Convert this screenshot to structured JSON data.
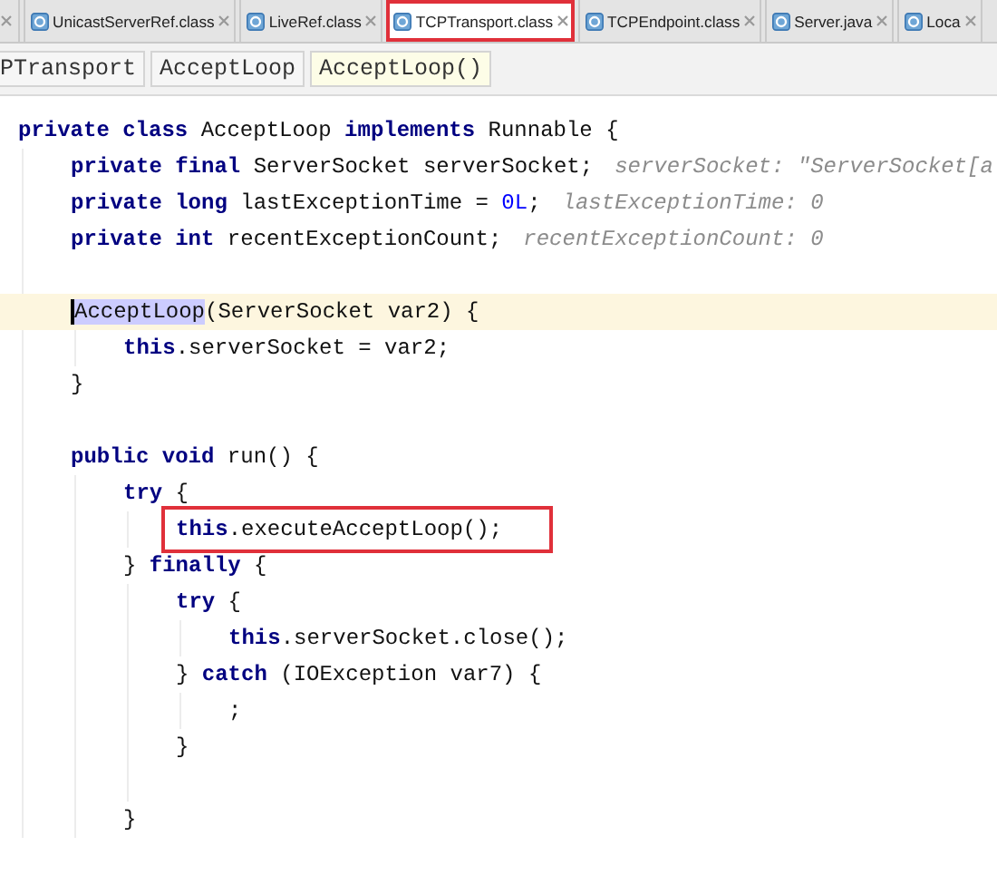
{
  "tabs": [
    {
      "label": "UnicastServerRef.class",
      "selected": false,
      "highlighted": false
    },
    {
      "label": "LiveRef.class",
      "selected": false,
      "highlighted": false
    },
    {
      "label": "TCPTransport.class",
      "selected": true,
      "highlighted": true
    },
    {
      "label": "TCPEndpoint.class",
      "selected": false,
      "highlighted": false
    },
    {
      "label": "Server.java",
      "selected": false,
      "highlighted": false
    },
    {
      "label": "Loca",
      "selected": false,
      "highlighted": false
    }
  ],
  "breadcrumbs": [
    {
      "label": "PTransport",
      "selected": false
    },
    {
      "label": "AcceptLoop",
      "selected": false
    },
    {
      "label": "AcceptLoop()",
      "selected": true
    }
  ],
  "code": [
    {
      "tokens": [
        {
          "kind": "keyword",
          "text": "private class"
        },
        {
          "kind": "plain",
          "text": " AcceptLoop "
        },
        {
          "kind": "keyword",
          "text": "implements"
        },
        {
          "kind": "plain",
          "text": " Runnable {"
        }
      ],
      "children": [
        {
          "tokens": [
            {
              "kind": "keyword",
              "text": "private final"
            },
            {
              "kind": "plain",
              "text": " ServerSocket serverSocket;"
            },
            {
              "kind": "hint",
              "text": "serverSocket: \"ServerSocket[a"
            }
          ]
        },
        {
          "tokens": [
            {
              "kind": "keyword",
              "text": "private long"
            },
            {
              "kind": "plain",
              "text": " lastExceptionTime = "
            },
            {
              "kind": "number",
              "text": "0L"
            },
            {
              "kind": "plain",
              "text": ";"
            },
            {
              "kind": "hint",
              "text": "lastExceptionTime: 0"
            }
          ]
        },
        {
          "tokens": [
            {
              "kind": "keyword",
              "text": "private int"
            },
            {
              "kind": "plain",
              "text": " recentExceptionCount;"
            },
            {
              "kind": "hint",
              "text": "recentExceptionCount: 0"
            }
          ]
        },
        {
          "kind": "blank"
        },
        {
          "current": true,
          "tokens": [
            {
              "kind": "selection",
              "text": "AcceptLoop"
            },
            {
              "kind": "plain",
              "text": "(ServerSocket var2) {"
            }
          ],
          "children": [
            {
              "tokens": [
                {
                  "kind": "keyword",
                  "text": "this"
                },
                {
                  "kind": "plain",
                  "text": ".serverSocket = var2;"
                }
              ]
            }
          ]
        },
        {
          "tokens": [
            {
              "kind": "plain",
              "text": "}"
            }
          ]
        },
        {
          "kind": "blank"
        },
        {
          "tokens": [
            {
              "kind": "keyword",
              "text": "public void"
            },
            {
              "kind": "plain",
              "text": " run() {"
            }
          ],
          "children": [
            {
              "tokens": [
                {
                  "kind": "keyword",
                  "text": "try"
                },
                {
                  "kind": "plain",
                  "text": " {"
                }
              ],
              "children": [
                {
                  "boxed": true,
                  "tokens": [
                    {
                      "kind": "keyword",
                      "text": "this"
                    },
                    {
                      "kind": "plain",
                      "text": ".executeAcceptLoop();"
                    }
                  ]
                }
              ]
            },
            {
              "tokens": [
                {
                  "kind": "plain",
                  "text": "} "
                },
                {
                  "kind": "keyword",
                  "text": "finally"
                },
                {
                  "kind": "plain",
                  "text": " {"
                }
              ],
              "children": [
                {
                  "tokens": [
                    {
                      "kind": "keyword",
                      "text": "try"
                    },
                    {
                      "kind": "plain",
                      "text": " {"
                    }
                  ],
                  "children": [
                    {
                      "tokens": [
                        {
                          "kind": "keyword",
                          "text": "this"
                        },
                        {
                          "kind": "plain",
                          "text": ".serverSocket.close();"
                        }
                      ]
                    }
                  ]
                },
                {
                  "tokens": [
                    {
                      "kind": "plain",
                      "text": "} "
                    },
                    {
                      "kind": "keyword",
                      "text": "catch"
                    },
                    {
                      "kind": "plain",
                      "text": " (IOException var7) {"
                    }
                  ],
                  "children": [
                    {
                      "tokens": [
                        {
                          "kind": "plain",
                          "text": ";"
                        }
                      ]
                    }
                  ]
                },
                {
                  "tokens": [
                    {
                      "kind": "plain",
                      "text": "}"
                    }
                  ]
                },
                {
                  "kind": "blank"
                }
              ]
            },
            {
              "tokens": [
                {
                  "kind": "plain",
                  "text": "}"
                }
              ]
            }
          ]
        }
      ]
    }
  ]
}
